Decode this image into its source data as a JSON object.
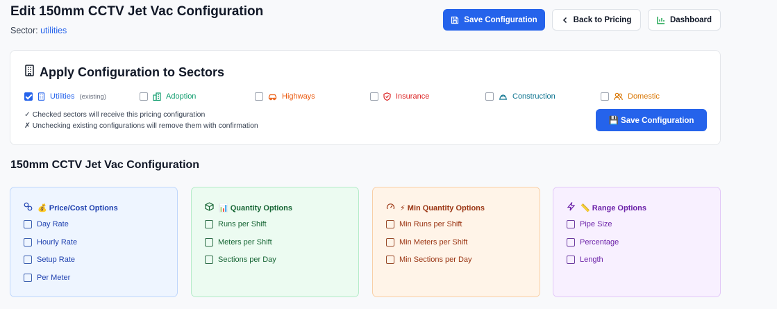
{
  "header": {
    "title": "Edit 150mm CCTV Jet Vac Configuration",
    "sector_label": "Sector:",
    "sector_value": "utilities"
  },
  "toolbar": {
    "save_label": "Save Configuration",
    "back_label": "Back to Pricing",
    "dashboard_label": "Dashboard"
  },
  "sectors": {
    "heading": "Apply Configuration to Sectors",
    "items": [
      {
        "label": "Utilities",
        "checked": true,
        "note": "(existing)",
        "color": "#2563eb",
        "icon": "building-icon"
      },
      {
        "label": "Adoption",
        "checked": false,
        "note": "",
        "color": "#0f9d6e",
        "icon": "apartment-icon"
      },
      {
        "label": "Highways",
        "checked": false,
        "note": "",
        "color": "#ea580c",
        "icon": "car-icon"
      },
      {
        "label": "Insurance",
        "checked": false,
        "note": "",
        "color": "#dc2626",
        "icon": "shield-icon"
      },
      {
        "label": "Construction",
        "checked": false,
        "note": "",
        "color": "#0e7490",
        "icon": "hard-hat-icon"
      },
      {
        "label": "Domestic",
        "checked": false,
        "note": "",
        "color": "#d97706",
        "icon": "users-icon"
      }
    ],
    "note_checked": "✓ Checked sectors will receive this pricing configuration",
    "note_unchecked": "✗ Unchecking existing configurations will remove them with confirmation",
    "save_label": "💾 Save Configuration"
  },
  "config": {
    "title": "150mm CCTV Jet Vac Configuration",
    "groups": [
      {
        "title": "💰 Price/Cost Options",
        "icon": "link-icon",
        "color": "#1e40af",
        "items": [
          "Day Rate",
          "Hourly Rate",
          "Setup Rate",
          "Per Meter"
        ]
      },
      {
        "title": "📊 Quantity Options",
        "icon": "cube-icon",
        "color": "#166534",
        "items": [
          "Runs per Shift",
          "Meters per Shift",
          "Sections per Day"
        ]
      },
      {
        "title": "⚡ Min Quantity Options",
        "icon": "gauge-icon",
        "color": "#9a3412",
        "items": [
          "Min Runs per Shift",
          "Min Meters per Shift",
          "Min Sections per Day"
        ]
      },
      {
        "title": "📏 Range Options",
        "icon": "bolt-icon",
        "color": "#6b21a8",
        "items": [
          "Pipe Size",
          "Percentage",
          "Length"
        ]
      }
    ]
  }
}
